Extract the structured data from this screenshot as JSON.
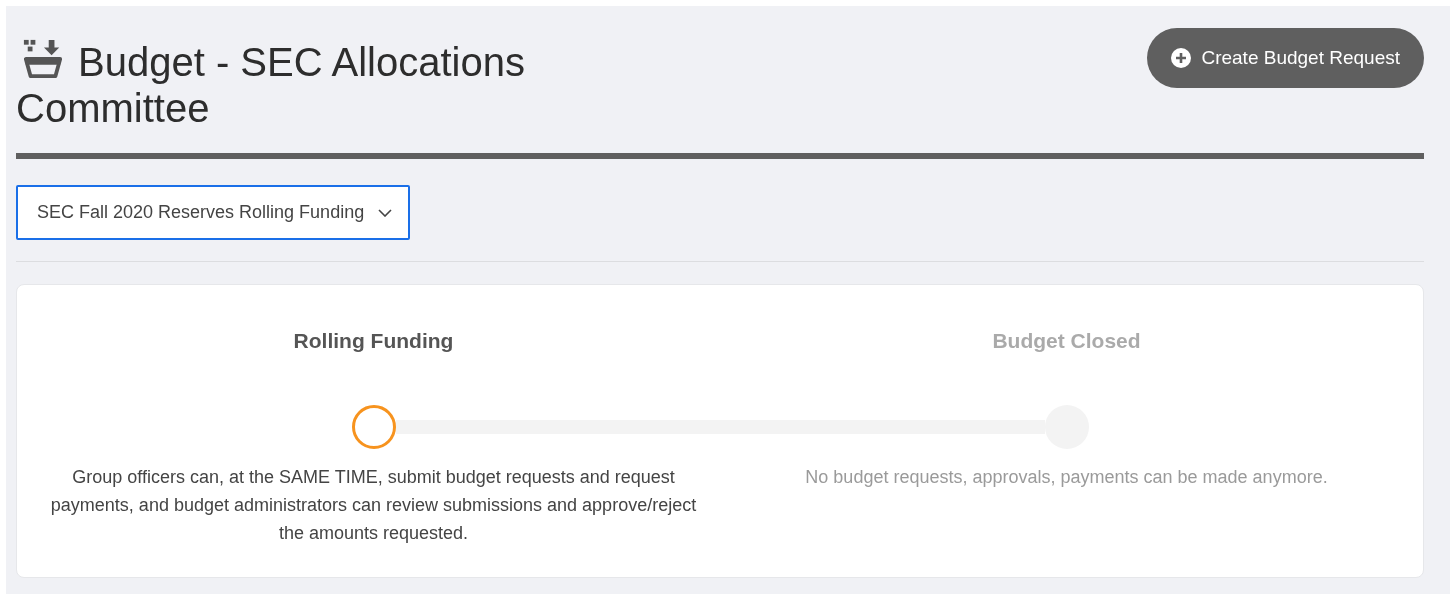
{
  "header": {
    "title": "Budget - SEC Allocations Committee",
    "button": "Create Budget Request"
  },
  "budget_select": {
    "value": "SEC Fall 2020 Reserves Rolling Funding"
  },
  "stages": [
    {
      "title": "Rolling Funding",
      "description": "Group officers can, at the SAME TIME, submit budget requests and request payments, and budget administrators can review submissions and approve/reject the amounts requested.",
      "current": true
    },
    {
      "title": "Budget Closed",
      "description": "No budget requests, approvals, payments can be made anymore.",
      "current": false
    }
  ]
}
